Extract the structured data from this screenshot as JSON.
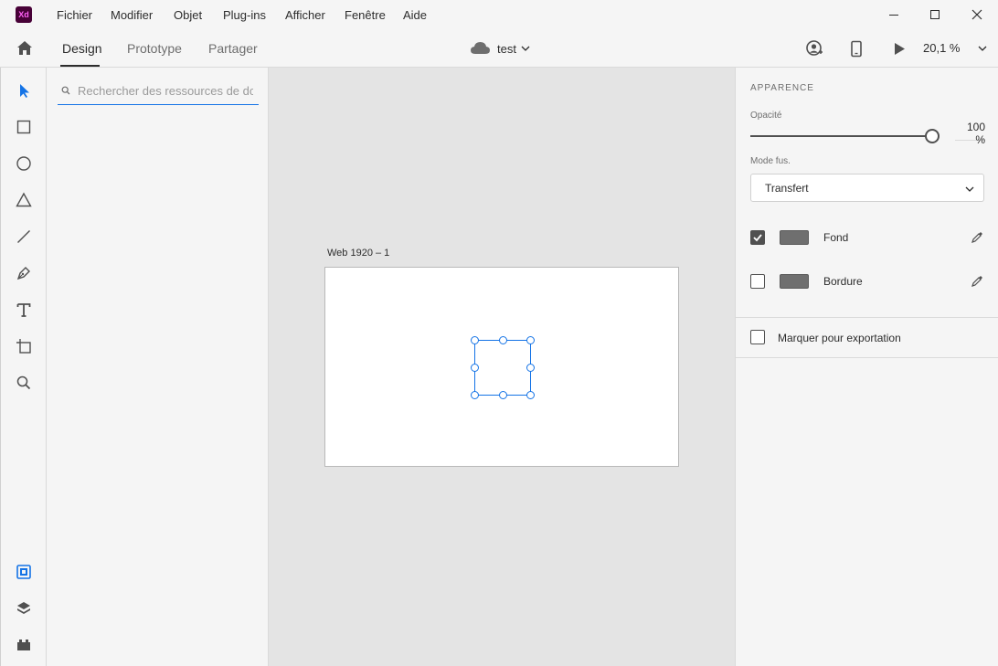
{
  "app": {
    "logo_text": "Xd",
    "menu": [
      "Fichier",
      "Modifier",
      "Objet",
      "Plug-ins",
      "Afficher",
      "Fenêtre",
      "Aide"
    ]
  },
  "modebar": {
    "tabs": [
      "Design",
      "Prototype",
      "Partager"
    ],
    "active_tab": "Design",
    "document_title": "test",
    "zoom": "20,1 %"
  },
  "assets": {
    "search_placeholder": "Rechercher des ressources de doc"
  },
  "canvas": {
    "artboard_name": "Web 1920 – 1"
  },
  "properties": {
    "section_title": "APPARENCE",
    "opacity_label": "Opacité",
    "opacity_value": "100 %",
    "opacity_fraction": 1.0,
    "blend_label": "Mode fus.",
    "blend_value": "Transfert",
    "fill_label": "Fond",
    "fill_checked": true,
    "border_label": "Bordure",
    "border_checked": false,
    "export_label": "Marquer pour exportation",
    "export_checked": false
  },
  "colors": {
    "accent": "#1473e6",
    "logo_bg": "#470137",
    "logo_fg": "#ff61f6",
    "swatch": "#6f6f6f"
  }
}
